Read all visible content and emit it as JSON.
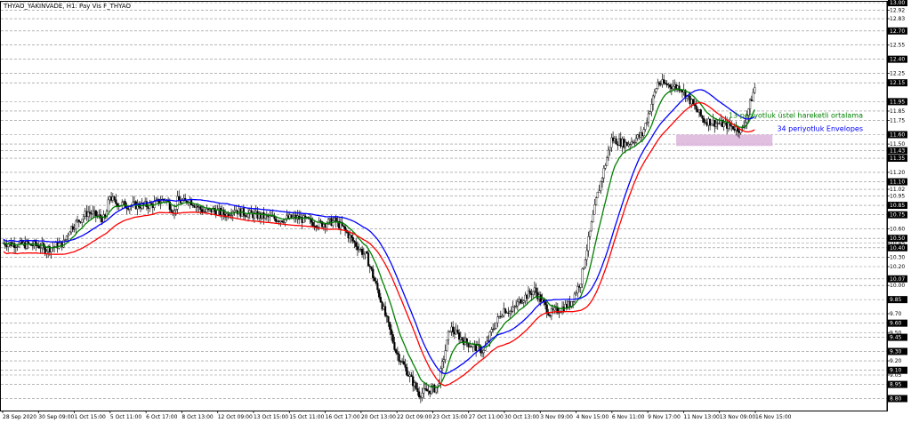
{
  "chart_data": {
    "type": "line",
    "title": "THYAO_YAKINVADE, H1:  Pay Vis F_THYAO",
    "ylim": [
      8.72,
      13.0
    ],
    "y_ticks": [
      "13.00",
      "12.92",
      "12.83",
      "12.70",
      "12.55",
      "12.40",
      "12.25",
      "12.15",
      "11.95",
      "11.85",
      "11.75",
      "11.60",
      "11.50",
      "11.43",
      "11.35",
      "11.20",
      "11.10",
      "11.02",
      "10.95",
      "10.85",
      "10.75",
      "10.60",
      "10.50",
      "10.45",
      "10.40",
      "10.30",
      "10.20",
      "10.07",
      "10.00",
      "9.85",
      "9.70",
      "9.60",
      "9.50",
      "9.45",
      "9.30",
      "9.20",
      "9.10",
      "9.05",
      "8.95",
      "8.80"
    ],
    "highlighted_ticks": [
      "13.00",
      "12.70",
      "12.40",
      "12.15",
      "11.95",
      "11.60",
      "11.43",
      "11.35",
      "11.10",
      "10.85",
      "10.75",
      "10.50",
      "10.40",
      "10.07",
      "9.85",
      "9.60",
      "9.45",
      "9.30",
      "9.10",
      "8.95",
      "8.80"
    ],
    "x_ticks": [
      "28 Sep 2020",
      "30 Sep 09:00",
      "1 Oct 15:00",
      "5 Oct 11:00",
      "6 Oct 17:00",
      "8 Oct 13:00",
      "12 Oct 09:00",
      "13 Oct 15:00",
      "15 Oct 11:00",
      "16 Oct 17:00",
      "20 Oct 13:00",
      "22 Oct 09:00",
      "23 Oct 15:00",
      "27 Oct 11:00",
      "30 Oct 13:00",
      "3 Nov 09:00",
      "4 Nov 15:00",
      "6 Nov 11:00",
      "9 Nov 17:00",
      "11 Nov 13:00",
      "13 Nov 09:00",
      "16 Nov 15:00"
    ],
    "anchors_x": [
      0,
      24,
      27,
      39,
      43,
      55,
      66,
      69,
      72,
      80,
      96,
      105,
      111,
      113,
      118,
      120,
      127,
      131,
      136,
      145,
      150,
      153,
      162
    ],
    "anchors_y": [
      10.45,
      10.42,
      10.38,
      10.45,
      10.6,
      10.78,
      10.7,
      10.95,
      10.88,
      10.85,
      10.85,
      10.92,
      10.78,
      10.9,
      10.88,
      10.92,
      10.82,
      10.78,
      10.8,
      10.75,
      10.82,
      10.78,
      10.75
    ],
    "anchors_x2": [
      162,
      180,
      190,
      205,
      215,
      220,
      228,
      236,
      244,
      255,
      270,
      282,
      290,
      300,
      312,
      318,
      325,
      330,
      336,
      345,
      355,
      368
    ],
    "anchors_y2": [
      10.75,
      10.7,
      10.72,
      10.65,
      10.68,
      10.62,
      10.45,
      10.3,
      9.9,
      9.3,
      8.85,
      8.92,
      9.55,
      9.4,
      9.3,
      9.55,
      9.75,
      9.72,
      9.85,
      9.95,
      9.7,
      9.8
    ],
    "anchors_x3": [
      368,
      375,
      385,
      395,
      405,
      415,
      425,
      440,
      455,
      470,
      480,
      488
    ],
    "anchors_y3": [
      9.8,
      10.05,
      10.9,
      11.55,
      11.5,
      11.6,
      12.15,
      12.1,
      11.75,
      11.7,
      11.65,
      12.1
    ],
    "n_bars": 489,
    "series": [
      {
        "name": "13 periyotluk üstel hareketli ortalama",
        "color": "#008000",
        "values": [],
        "mode": "ema",
        "period": 13
      },
      {
        "name": "34 periyotluk Envelopes",
        "color": "#0000ff",
        "values": [],
        "mode": "env_upper",
        "period": 34
      },
      {
        "name": "",
        "color": "#ff0000",
        "values": [],
        "mode": "env_lower",
        "period": 34
      }
    ],
    "candle_color": "#000000",
    "zone": {
      "low": 11.48,
      "high": 11.6,
      "color": "#dcb4dc"
    },
    "grid": true,
    "annotations": [
      {
        "text": "13 periyotluk üstel hareketli ortalama",
        "color": "#008000",
        "y": 11.78
      },
      {
        "text": "34 periyotluk Envelopes",
        "color": "#0000ff",
        "y": 11.64
      }
    ]
  }
}
